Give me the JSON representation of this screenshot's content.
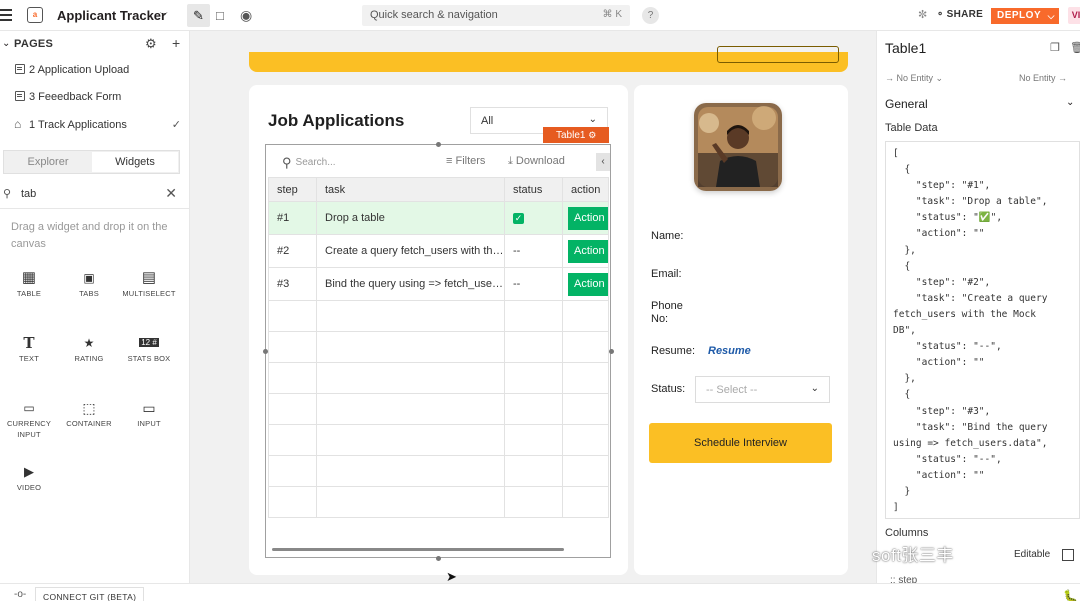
{
  "topbar": {
    "app_name": "Applicant Tracker",
    "search_placeholder": "Quick search & navigation",
    "search_shortcut": "⌘ K",
    "help": "?",
    "share_label": "SHARE",
    "deploy_label": "DEPLOY",
    "user_initials": "VI"
  },
  "left_panel": {
    "pages_title": "PAGES",
    "pages": [
      {
        "label": "2 Application Upload"
      },
      {
        "label": "3 Feeedback Form"
      },
      {
        "label": "1 Track Applications"
      }
    ],
    "tabs": [
      "Explorer",
      "Widgets"
    ],
    "search_value": "tab",
    "hint": "Drag a widget and drop it on the canvas",
    "widgets": [
      {
        "label": "TABLE",
        "icon": "table-icon"
      },
      {
        "label": "TABS",
        "icon": "tabs-icon"
      },
      {
        "label": "MULTISELECT",
        "icon": "multiselect-icon"
      },
      {
        "label": "TEXT",
        "icon": "text-icon"
      },
      {
        "label": "RATING",
        "icon": "star-icon"
      },
      {
        "label": "STATS BOX",
        "icon": "stats-box-icon"
      },
      {
        "label": "CURRENCY INPUT",
        "icon": "currency-input-icon"
      },
      {
        "label": "CONTAINER",
        "icon": "container-icon"
      },
      {
        "label": "INPUT",
        "icon": "input-icon"
      },
      {
        "label": "VIDEO",
        "icon": "video-icon"
      }
    ]
  },
  "canvas": {
    "title": "Job Applications",
    "filter_value": "All",
    "table_tag": "Table1",
    "table": {
      "search_placeholder": "Search...",
      "filters_label": "Filters",
      "download_label": "Download",
      "columns": [
        "step",
        "task",
        "status",
        "action"
      ],
      "rows": [
        {
          "step": "#1",
          "task": "Drop a table",
          "status": "✓",
          "action": "Action"
        },
        {
          "step": "#2",
          "task": "Create a query fetch_users with the Mock DB",
          "status": "--",
          "action": "Action"
        },
        {
          "step": "#3",
          "task": "Bind the query using => fetch_users.data",
          "status": "--",
          "action": "Action"
        }
      ]
    },
    "profile": {
      "name_label": "Name:",
      "email_label": "Email:",
      "phone_label": "Phone No:",
      "resume_label": "Resume:",
      "resume_link": "Resume",
      "status_label": "Status:",
      "status_placeholder": "-- Select --",
      "schedule_button": "Schedule Interview"
    }
  },
  "property_pane": {
    "widget_name": "Table1",
    "entity_left": "No Entity",
    "entity_right": "No Entity",
    "section": "General",
    "table_data_label": "Table Data",
    "table_data_json": "[\n  {\n    \"step\": \"#1\",\n    \"task\": \"Drop a table\",\n    \"status\": \"✅\",\n    \"action\": \"\"\n  },\n  {\n    \"step\": \"#2\",\n    \"task\": \"Create a query\nfetch_users with the Mock\nDB\",\n    \"status\": \"--\",\n    \"action\": \"\"\n  },\n  {\n    \"step\": \"#3\",\n    \"task\": \"Bind the query\nusing => fetch_users.data\",\n    \"status\": \"--\",\n    \"action\": \"\"\n  }\n]",
    "columns_label": "Columns",
    "editable_label": "Editable",
    "next_column": ":: step"
  },
  "watermark": "soft张三丰",
  "bottom": {
    "git_label": "CONNECT GIT (BETA)"
  },
  "colors": {
    "accent": "#f86a2b",
    "primary_green": "#03b365",
    "yellow": "#fbbf24",
    "link_blue": "#1e5aa8"
  }
}
